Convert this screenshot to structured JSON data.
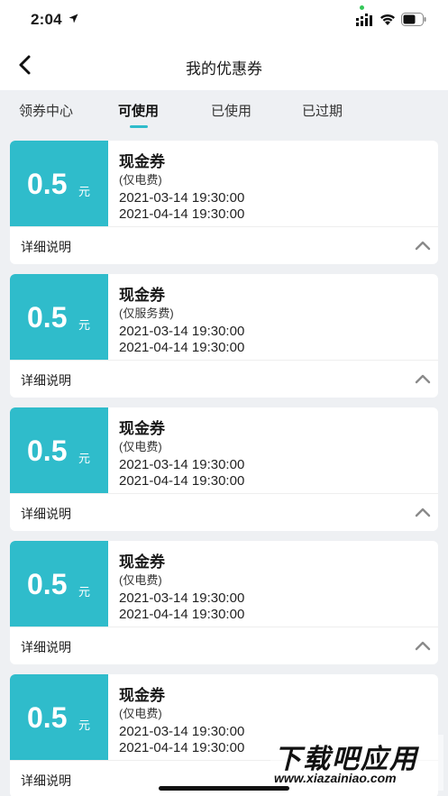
{
  "status_bar": {
    "time": "2:04"
  },
  "nav": {
    "title": "我的优惠券"
  },
  "tabs": [
    {
      "label": "领券中心"
    },
    {
      "label": "可使用"
    },
    {
      "label": "已使用"
    },
    {
      "label": "已过期"
    }
  ],
  "active_tab": "可使用",
  "coupons": [
    {
      "amount": "0.5",
      "unit": "元",
      "name": "现金券",
      "scope": "(仅电费)",
      "start": "2021-03-14 19:30:00",
      "end": "2021-04-14 19:30:00",
      "detail_label": "详细说明"
    },
    {
      "amount": "0.5",
      "unit": "元",
      "name": "现金券",
      "scope": "(仅服务费)",
      "start": "2021-03-14 19:30:00",
      "end": "2021-04-14 19:30:00",
      "detail_label": "详细说明"
    },
    {
      "amount": "0.5",
      "unit": "元",
      "name": "现金券",
      "scope": "(仅电费)",
      "start": "2021-03-14 19:30:00",
      "end": "2021-04-14 19:30:00",
      "detail_label": "详细说明"
    },
    {
      "amount": "0.5",
      "unit": "元",
      "name": "现金券",
      "scope": "(仅电费)",
      "start": "2021-03-14 19:30:00",
      "end": "2021-04-14 19:30:00",
      "detail_label": "详细说明"
    },
    {
      "amount": "0.5",
      "unit": "元",
      "name": "现金券",
      "scope": "(仅电费)",
      "start": "2021-03-14 19:30:00",
      "end": "2021-04-14 19:30:00",
      "detail_label": "详细说明"
    }
  ],
  "watermark": {
    "main": "下载吧应用",
    "sub": "www.xiazainiao.com"
  },
  "colors": {
    "accent": "#2fbccb",
    "background": "#eef0f3"
  }
}
